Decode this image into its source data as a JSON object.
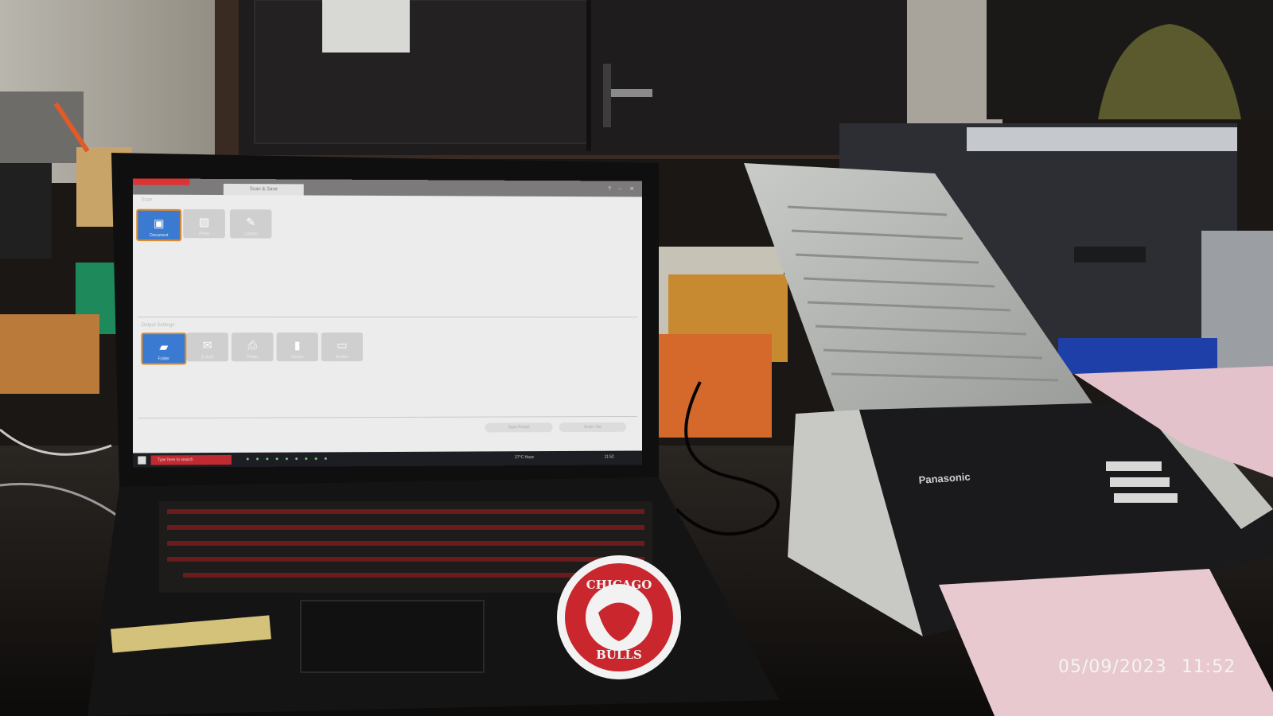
{
  "app": {
    "window_tab": "Scan & Save",
    "scan_section_label": "Scan",
    "output_section_label": "Output Settings",
    "scan_thumbs": [
      {
        "label": "Document",
        "icon": "document-scan-icon",
        "selected": true
      },
      {
        "label": "Photo",
        "icon": "photo-scan-icon",
        "selected": false
      },
      {
        "label": "Custom",
        "icon": "custom-scan-icon",
        "selected": false
      }
    ],
    "output_thumbs": [
      {
        "label": "Folder",
        "icon": "folder-icon",
        "selected": true
      },
      {
        "label": "E-mail",
        "icon": "mail-icon",
        "selected": false
      },
      {
        "label": "Printer",
        "icon": "printer-icon",
        "selected": false
      },
      {
        "label": "Device",
        "icon": "device-icon",
        "selected": false
      },
      {
        "label": "Screen",
        "icon": "screen-icon",
        "selected": false
      }
    ],
    "buttons": {
      "save_preset": "Save Preset",
      "scan": "Scan / Go"
    },
    "taskbar_search": "Type here to search",
    "taskbar_tray": "27°C Haze",
    "taskbar_clock": "11:52"
  },
  "scanner_brand": "Panasonic",
  "sticker_text": {
    "top": "CHICAGO",
    "bottom": "BULLS"
  },
  "photo_timestamp": {
    "date": "05/09/2023",
    "time": "11:52"
  },
  "colors": {
    "accent_red": "#d33333",
    "selected_blue": "#3a7ad0",
    "selected_border": "#e18a2a"
  }
}
